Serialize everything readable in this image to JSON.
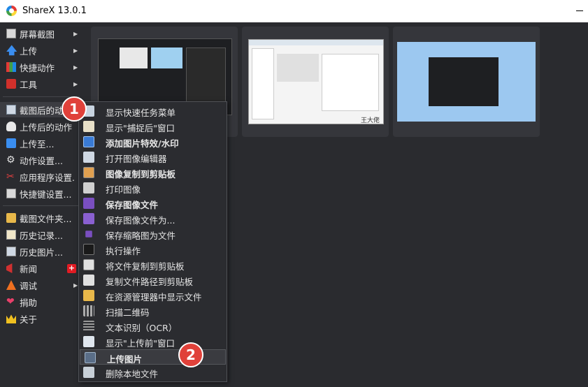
{
  "window": {
    "title": "ShareX 13.0.1"
  },
  "sidebar": {
    "items": [
      {
        "label": "屏幕截图",
        "icon": "screenshot-icon",
        "submenu": true
      },
      {
        "label": "上传",
        "icon": "upload-arrow-icon",
        "submenu": true
      },
      {
        "label": "快捷动作",
        "icon": "quick-actions-icon",
        "submenu": true
      },
      {
        "label": "工具",
        "icon": "toolbox-icon",
        "submenu": true
      },
      {
        "label": "截图后的动作",
        "icon": "after-capture-icon",
        "submenu": true
      },
      {
        "label": "上传后的动作",
        "icon": "cloud-upload-icon",
        "submenu": true
      },
      {
        "label": "上传至...",
        "icon": "upload-destination-icon",
        "submenu": true
      },
      {
        "label": "动作设置...",
        "icon": "gear-icon",
        "submenu": false
      },
      {
        "label": "应用程序设置...",
        "icon": "tools-icon",
        "submenu": false
      },
      {
        "label": "快捷键设置...",
        "icon": "keyboard-icon",
        "submenu": false
      },
      {
        "label": "截图文件夹...",
        "icon": "folder-icon",
        "submenu": false
      },
      {
        "label": "历史记录...",
        "icon": "history-icon",
        "submenu": false
      },
      {
        "label": "历史图片...",
        "icon": "image-history-icon",
        "submenu": false
      },
      {
        "label": "新闻",
        "icon": "megaphone-icon",
        "submenu": false
      },
      {
        "label": "调试",
        "icon": "debug-cone-icon",
        "submenu": true
      },
      {
        "label": "捐助",
        "icon": "heart-icon",
        "submenu": false
      },
      {
        "label": "关于",
        "icon": "crown-icon",
        "submenu": false
      }
    ],
    "news_badge": "+"
  },
  "after_capture_menu": {
    "items": [
      {
        "label": "显示快速任务菜单",
        "bold": false
      },
      {
        "label": "显示\"捕捉后\"窗口",
        "bold": false
      },
      {
        "label": "添加图片特效/水印",
        "bold": true
      },
      {
        "label": "打开图像编辑器",
        "bold": false
      },
      {
        "label": "图像复制到剪贴板",
        "bold": true
      },
      {
        "label": "打印图像",
        "bold": false
      },
      {
        "label": "保存图像文件",
        "bold": true
      },
      {
        "label": "保存图像文件为...",
        "bold": false
      },
      {
        "label": "保存缩略图为文件",
        "bold": false
      },
      {
        "label": "执行操作",
        "bold": false
      },
      {
        "label": "将文件复制到剪贴板",
        "bold": false
      },
      {
        "label": "复制文件路径到剪贴板",
        "bold": false
      },
      {
        "label": "在资源管理器中显示文件",
        "bold": false
      },
      {
        "label": "扫描二维码",
        "bold": false
      },
      {
        "label": "文本识别（OCR）",
        "bold": false
      },
      {
        "label": "显示\"上传前\"窗口",
        "bold": false
      },
      {
        "label": "上传图片",
        "bold": true
      },
      {
        "label": "删除本地文件",
        "bold": false
      }
    ]
  },
  "thumbnails": [
    {
      "name": "screenshot-1"
    },
    {
      "name": "screenshot-2",
      "watermark": "王大佬"
    },
    {
      "name": "screenshot-3"
    }
  ],
  "annotations": {
    "step1": "1",
    "step2": "2"
  },
  "colors": {
    "accent_red": "#e0413a",
    "badge_red": "#e21b23",
    "background": "#2a2b2f"
  }
}
